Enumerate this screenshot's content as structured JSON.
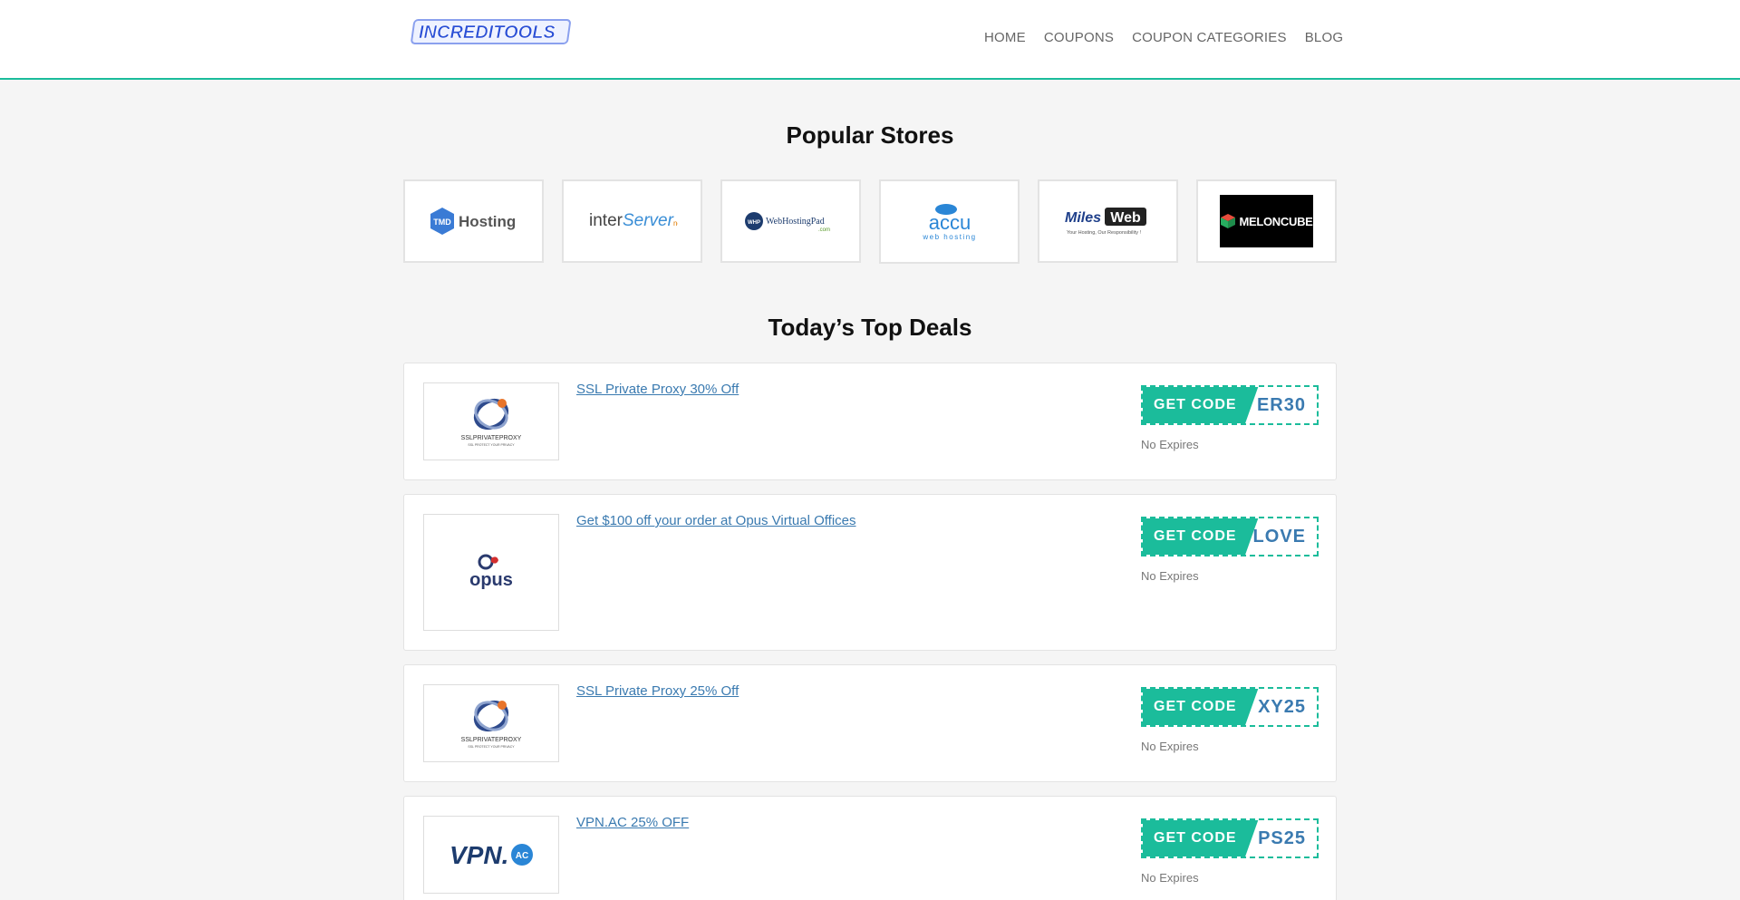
{
  "header": {
    "logo_text": "INCREDITOOLS",
    "nav": [
      "HOME",
      "COUPONS",
      "COUPON CATEGORIES",
      "BLOG"
    ]
  },
  "popular": {
    "title": "Popular Stores",
    "stores": [
      {
        "name": "TMDHosting",
        "logo_badge": "TMD",
        "logo_word": "Hosting"
      },
      {
        "name": "interServer",
        "logo_a": "inter",
        "logo_b": "Server",
        "logo_c": "net"
      },
      {
        "name": "WebHostingPad",
        "logo_badge": "WHP",
        "logo_word": "WebHostingPad",
        "logo_sub": ".com"
      },
      {
        "name": "Accu Web Hosting",
        "logo_word": "accu",
        "logo_sub": "web hosting"
      },
      {
        "name": "MilesWeb",
        "logo_a": "Miles",
        "logo_b": "Web",
        "logo_sub": "Your Hosting, Our Responsibility !"
      },
      {
        "name": "MelonCube",
        "logo_word": "MELONCUBE"
      }
    ]
  },
  "deals": {
    "title": "Today’s Top Deals",
    "items": [
      {
        "title": "SSL Private Proxy 30% Off",
        "code": "ER30",
        "get_label": "GET CODE",
        "expires": "No Expires",
        "logo": "SSLPRIVATEPROXY",
        "logo_sub": "SSL PROTECT YOUR PRIVACY"
      },
      {
        "title": "Get $100 off your order at Opus Virtual Offices",
        "code": "LOVE",
        "get_label": "GET CODE",
        "expires": "No Expires",
        "logo": "opus"
      },
      {
        "title": "SSL Private Proxy 25% Off",
        "code": "XY25",
        "get_label": "GET CODE",
        "expires": "No Expires",
        "logo": "SSLPRIVATEPROXY",
        "logo_sub": "SSL PROTECT YOUR PRIVACY"
      },
      {
        "title": "VPN.AC 25% OFF",
        "code": "PS25",
        "get_label": "GET CODE",
        "expires": "No Expires",
        "logo": "VPN.",
        "logo_badge": "AC"
      }
    ]
  },
  "colors": {
    "accent": "#1bbc9b",
    "link": "#3a7ab0",
    "logo_blue": "#2a4fd6"
  }
}
